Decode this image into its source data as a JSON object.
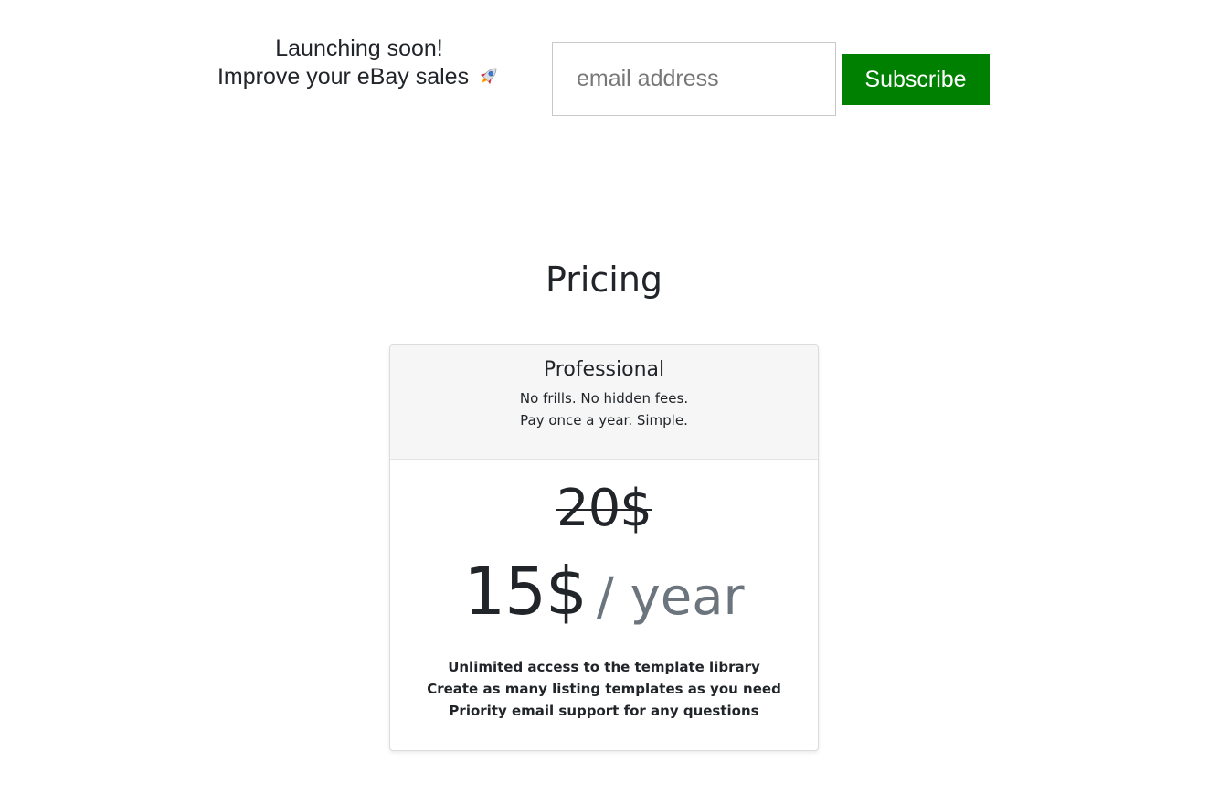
{
  "subscribe": {
    "headline": "Launching soon!",
    "subheadline": "Improve your eBay sales",
    "email_placeholder": "email address",
    "button_label": "Subscribe",
    "button_color": "#008000",
    "icon": "rocket-icon"
  },
  "pricing": {
    "title": "Pricing",
    "plan": {
      "name": "Professional",
      "taglines": [
        "No frills. No hidden fees.",
        "Pay once a year. Simple."
      ],
      "old_price": "20$",
      "price": "15$",
      "period": "/ year",
      "features": [
        "Unlimited access to the template library",
        "Create as many listing templates as you need",
        "Priority email support for any questions"
      ]
    }
  }
}
